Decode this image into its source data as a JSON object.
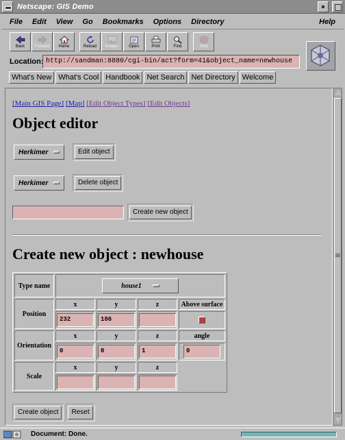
{
  "window": {
    "title": "Netscape: GIS Demo"
  },
  "menubar": {
    "items": [
      "File",
      "Edit",
      "View",
      "Go",
      "Bookmarks",
      "Options",
      "Directory"
    ],
    "help": "Help"
  },
  "toolbar": {
    "back": {
      "label": "Back",
      "icon": "back-arrow-icon",
      "enabled": true
    },
    "forward": {
      "label": "Forward",
      "icon": "forward-arrow-icon",
      "enabled": false
    },
    "home": {
      "label": "Home",
      "icon": "home-icon",
      "enabled": true
    },
    "reload": {
      "label": "Reload",
      "icon": "reload-icon",
      "enabled": true
    },
    "images": {
      "label": "Images",
      "icon": "images-icon",
      "enabled": false
    },
    "open": {
      "label": "Open",
      "icon": "open-icon",
      "enabled": true
    },
    "print": {
      "label": "Print",
      "icon": "print-icon",
      "enabled": true
    },
    "find": {
      "label": "Find",
      "icon": "find-icon",
      "enabled": true
    },
    "stop": {
      "label": "Stop",
      "icon": "stop-icon",
      "enabled": false
    }
  },
  "location": {
    "label": "Location:",
    "url": "http://sandman:8880/cgi-bin/act?form=41&object_name=newhouse"
  },
  "directory_buttons": [
    "What's New",
    "What's Cool",
    "Handbook",
    "Net Search",
    "Net Directory",
    "Welcome"
  ],
  "page": {
    "breadcrumbs": [
      "[Main GIS Page]",
      "[Map]",
      "[Edit Object Types]",
      "[Edit Objects]"
    ],
    "heading1": "Object editor",
    "edit_row": {
      "select": "Herkimer",
      "button": "Edit object"
    },
    "delete_row": {
      "select": "Herkimer",
      "button": "Delete object"
    },
    "create_row": {
      "input_value": "",
      "button": "Create new object"
    },
    "heading2": "Create new object : newhouse",
    "form": {
      "type_name_label": "Type name",
      "type_value": "house1",
      "position_label": "Position",
      "orientation_label": "Orientation",
      "scale_label": "Scale",
      "col_x": "x",
      "col_y": "y",
      "col_z": "z",
      "above_surface_label": "Above surface",
      "angle_label": "angle",
      "position": {
        "x": "232",
        "y": "186",
        "z": ""
      },
      "above_surface_checked": true,
      "orientation": {
        "x": "0",
        "y": "0",
        "z": "1",
        "angle": "0"
      },
      "scale": {
        "x": "",
        "y": "",
        "z": ""
      }
    },
    "submit_button": "Create object",
    "reset_button": "Reset"
  },
  "status": {
    "text": "Document: Done."
  },
  "colors": {
    "background": "#bdbdbd",
    "field": "#dbb3b3",
    "link": "#1a1aa8",
    "visited_link": "#6a3a8a",
    "progress": "#6fb8b8"
  }
}
